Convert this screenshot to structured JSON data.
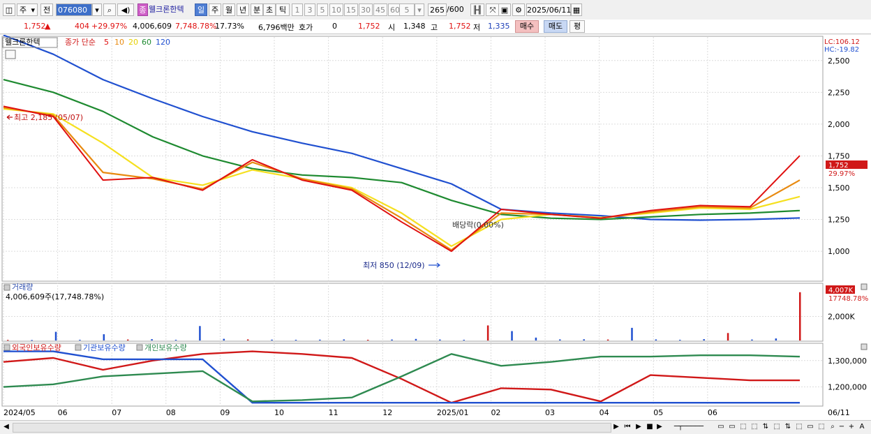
{
  "toolbar": {
    "period_unit": "주",
    "prev_label": "전",
    "stock_code": "076080",
    "stock_name": "웰크론한텍",
    "badge": "종",
    "tab_day": "일",
    "tab_week": "주",
    "tab_month": "월",
    "tab_year": "년",
    "tab_minute": "분",
    "tab_second": "초",
    "tab_tick": "틱",
    "intervals": [
      "1",
      "3",
      "5",
      "10",
      "15",
      "30",
      "45",
      "60"
    ],
    "interval_value": "5",
    "count_display": "265",
    "count_total": "/600",
    "date": "2025/06/11"
  },
  "quote": {
    "price": "1,752",
    "change": "404",
    "change_pct": "+29.97%",
    "volume": "4,006,609",
    "volume_ratio": "7,748.78%",
    "turnover": "17.73%",
    "amount": "6,796백만",
    "ask_label": "호가",
    "ask_value": "0",
    "ask_price": "1,752",
    "open_label": "시",
    "open": "1,348",
    "high_label": "고",
    "high": "1,752",
    "low_label": "저",
    "low": "1,335",
    "buy_label": "매수",
    "sell_label": "매도",
    "avg_label": "평"
  },
  "price_panel": {
    "name": "웰크론한텍",
    "ma_prefix": "종가 단순",
    "ma_periods": [
      "5",
      "10",
      "20",
      "60",
      "120"
    ],
    "ma_colors": [
      "#e01010",
      "#e88a10",
      "#f5e020",
      "#1e8a30",
      "#2050d0"
    ],
    "lc_label": "LC:106.12",
    "hc_label": "HC:-19.82",
    "high_annotation": "최고 2,185 (05/07)",
    "low_annotation": "최저 850 (12/09)",
    "dividend_annotation": "배당락(0.00%)",
    "last_price_tag": "1,752",
    "last_change_tag": "29.97%"
  },
  "volume_panel": {
    "title": "거래량",
    "info": "4,006,609주(17,748.78%)",
    "last_tag": "4,007K",
    "last_pct": "17748.78%"
  },
  "holdings_panel": {
    "series": [
      {
        "name": "외국인보유수량",
        "color": "#d01818"
      },
      {
        "name": "기관보유수량",
        "color": "#2050d0"
      },
      {
        "name": "개인보유수량",
        "color": "#2e8a50"
      }
    ]
  },
  "x_labels": [
    "2024/05",
    "06",
    "07",
    "08",
    "09",
    "10",
    "11",
    "12",
    "2025/01",
    "02",
    "03",
    "04",
    "05",
    "06",
    "06/11"
  ],
  "chart_data": [
    {
      "type": "line",
      "title": "웰크론한텍",
      "ylim": [
        770,
        2680
      ],
      "yticks": [
        "1,000",
        "1,250",
        "1,500",
        "1,750",
        "2,000",
        "2,250",
        "2,500"
      ],
      "yvalues": [
        1000,
        1250,
        1500,
        1750,
        2000,
        2250,
        2500
      ],
      "x": [
        "2024/05",
        "06",
        "07",
        "08",
        "09",
        "10",
        "11",
        "12",
        "2025/01",
        "02",
        "03",
        "04",
        "05",
        "06",
        "06/11"
      ],
      "series": [
        {
          "values": [
            2140,
            2060,
            1560,
            1580,
            1480,
            1720,
            1560,
            1480,
            1230,
            1000,
            1330,
            1290,
            1260,
            1320,
            1360,
            1350,
            1752
          ]
        },
        {
          "values": [
            2130,
            2070,
            1620,
            1570,
            1490,
            1700,
            1570,
            1490,
            1260,
            1010,
            1300,
            1290,
            1260,
            1310,
            1350,
            1340,
            1560
          ]
        },
        {
          "values": [
            2120,
            2080,
            1850,
            1580,
            1520,
            1640,
            1570,
            1500,
            1300,
            1040,
            1250,
            1290,
            1265,
            1300,
            1340,
            1330,
            1430
          ]
        },
        {
          "values": [
            2350,
            2250,
            2100,
            1900,
            1750,
            1650,
            1600,
            1580,
            1540,
            1400,
            1290,
            1260,
            1250,
            1270,
            1290,
            1300,
            1320
          ]
        },
        {
          "values": [
            2700,
            2550,
            2350,
            2200,
            2060,
            1940,
            1850,
            1770,
            1650,
            1530,
            1330,
            1300,
            1280,
            1250,
            1245,
            1250,
            1262
          ]
        }
      ]
    },
    {
      "type": "bar",
      "title": "거래량",
      "ylim": [
        0,
        4400
      ],
      "yticks": [
        "2,000K"
      ],
      "yvalues": [
        2000
      ],
      "values": [
        50,
        40,
        720,
        60,
        520,
        80,
        110,
        60,
        1200,
        140,
        90,
        70,
        60,
        70,
        90,
        60,
        80,
        130,
        80,
        60,
        1250,
        780,
        240,
        90,
        100,
        80,
        1050,
        90,
        60,
        110,
        620,
        80,
        170,
        4007
      ]
    },
    {
      "type": "line",
      "title": "외국인보유수량 / 기관보유수량 / 개인보유수량",
      "ylim": [
        1130000,
        1355000
      ],
      "yticks": [
        "1,200,000",
        "1,300,000"
      ],
      "yvalues": [
        1200000,
        1300000
      ],
      "series": [
        {
          "name": "외국인보유수량",
          "values": [
            1295000,
            1310000,
            1265000,
            1300000,
            1325000,
            1335000,
            1325000,
            1310000,
            1230000,
            1140000,
            1195000,
            1190000,
            1145000,
            1245000,
            1235000,
            1225000,
            1225000
          ]
        },
        {
          "name": "기관보유수량",
          "values": [
            1335000,
            1335000,
            1305000,
            1305000,
            1305000,
            1140000,
            1140000,
            1140000,
            1140000,
            1140000,
            1140000,
            1140000,
            1140000,
            1140000,
            1140000,
            1140000,
            1140000
          ]
        },
        {
          "name": "개인보유수량",
          "values": [
            1200000,
            1210000,
            1240000,
            1250000,
            1260000,
            1145000,
            1150000,
            1160000,
            1240000,
            1325000,
            1280000,
            1295000,
            1315000,
            1315000,
            1320000,
            1320000,
            1315000
          ]
        }
      ]
    }
  ]
}
